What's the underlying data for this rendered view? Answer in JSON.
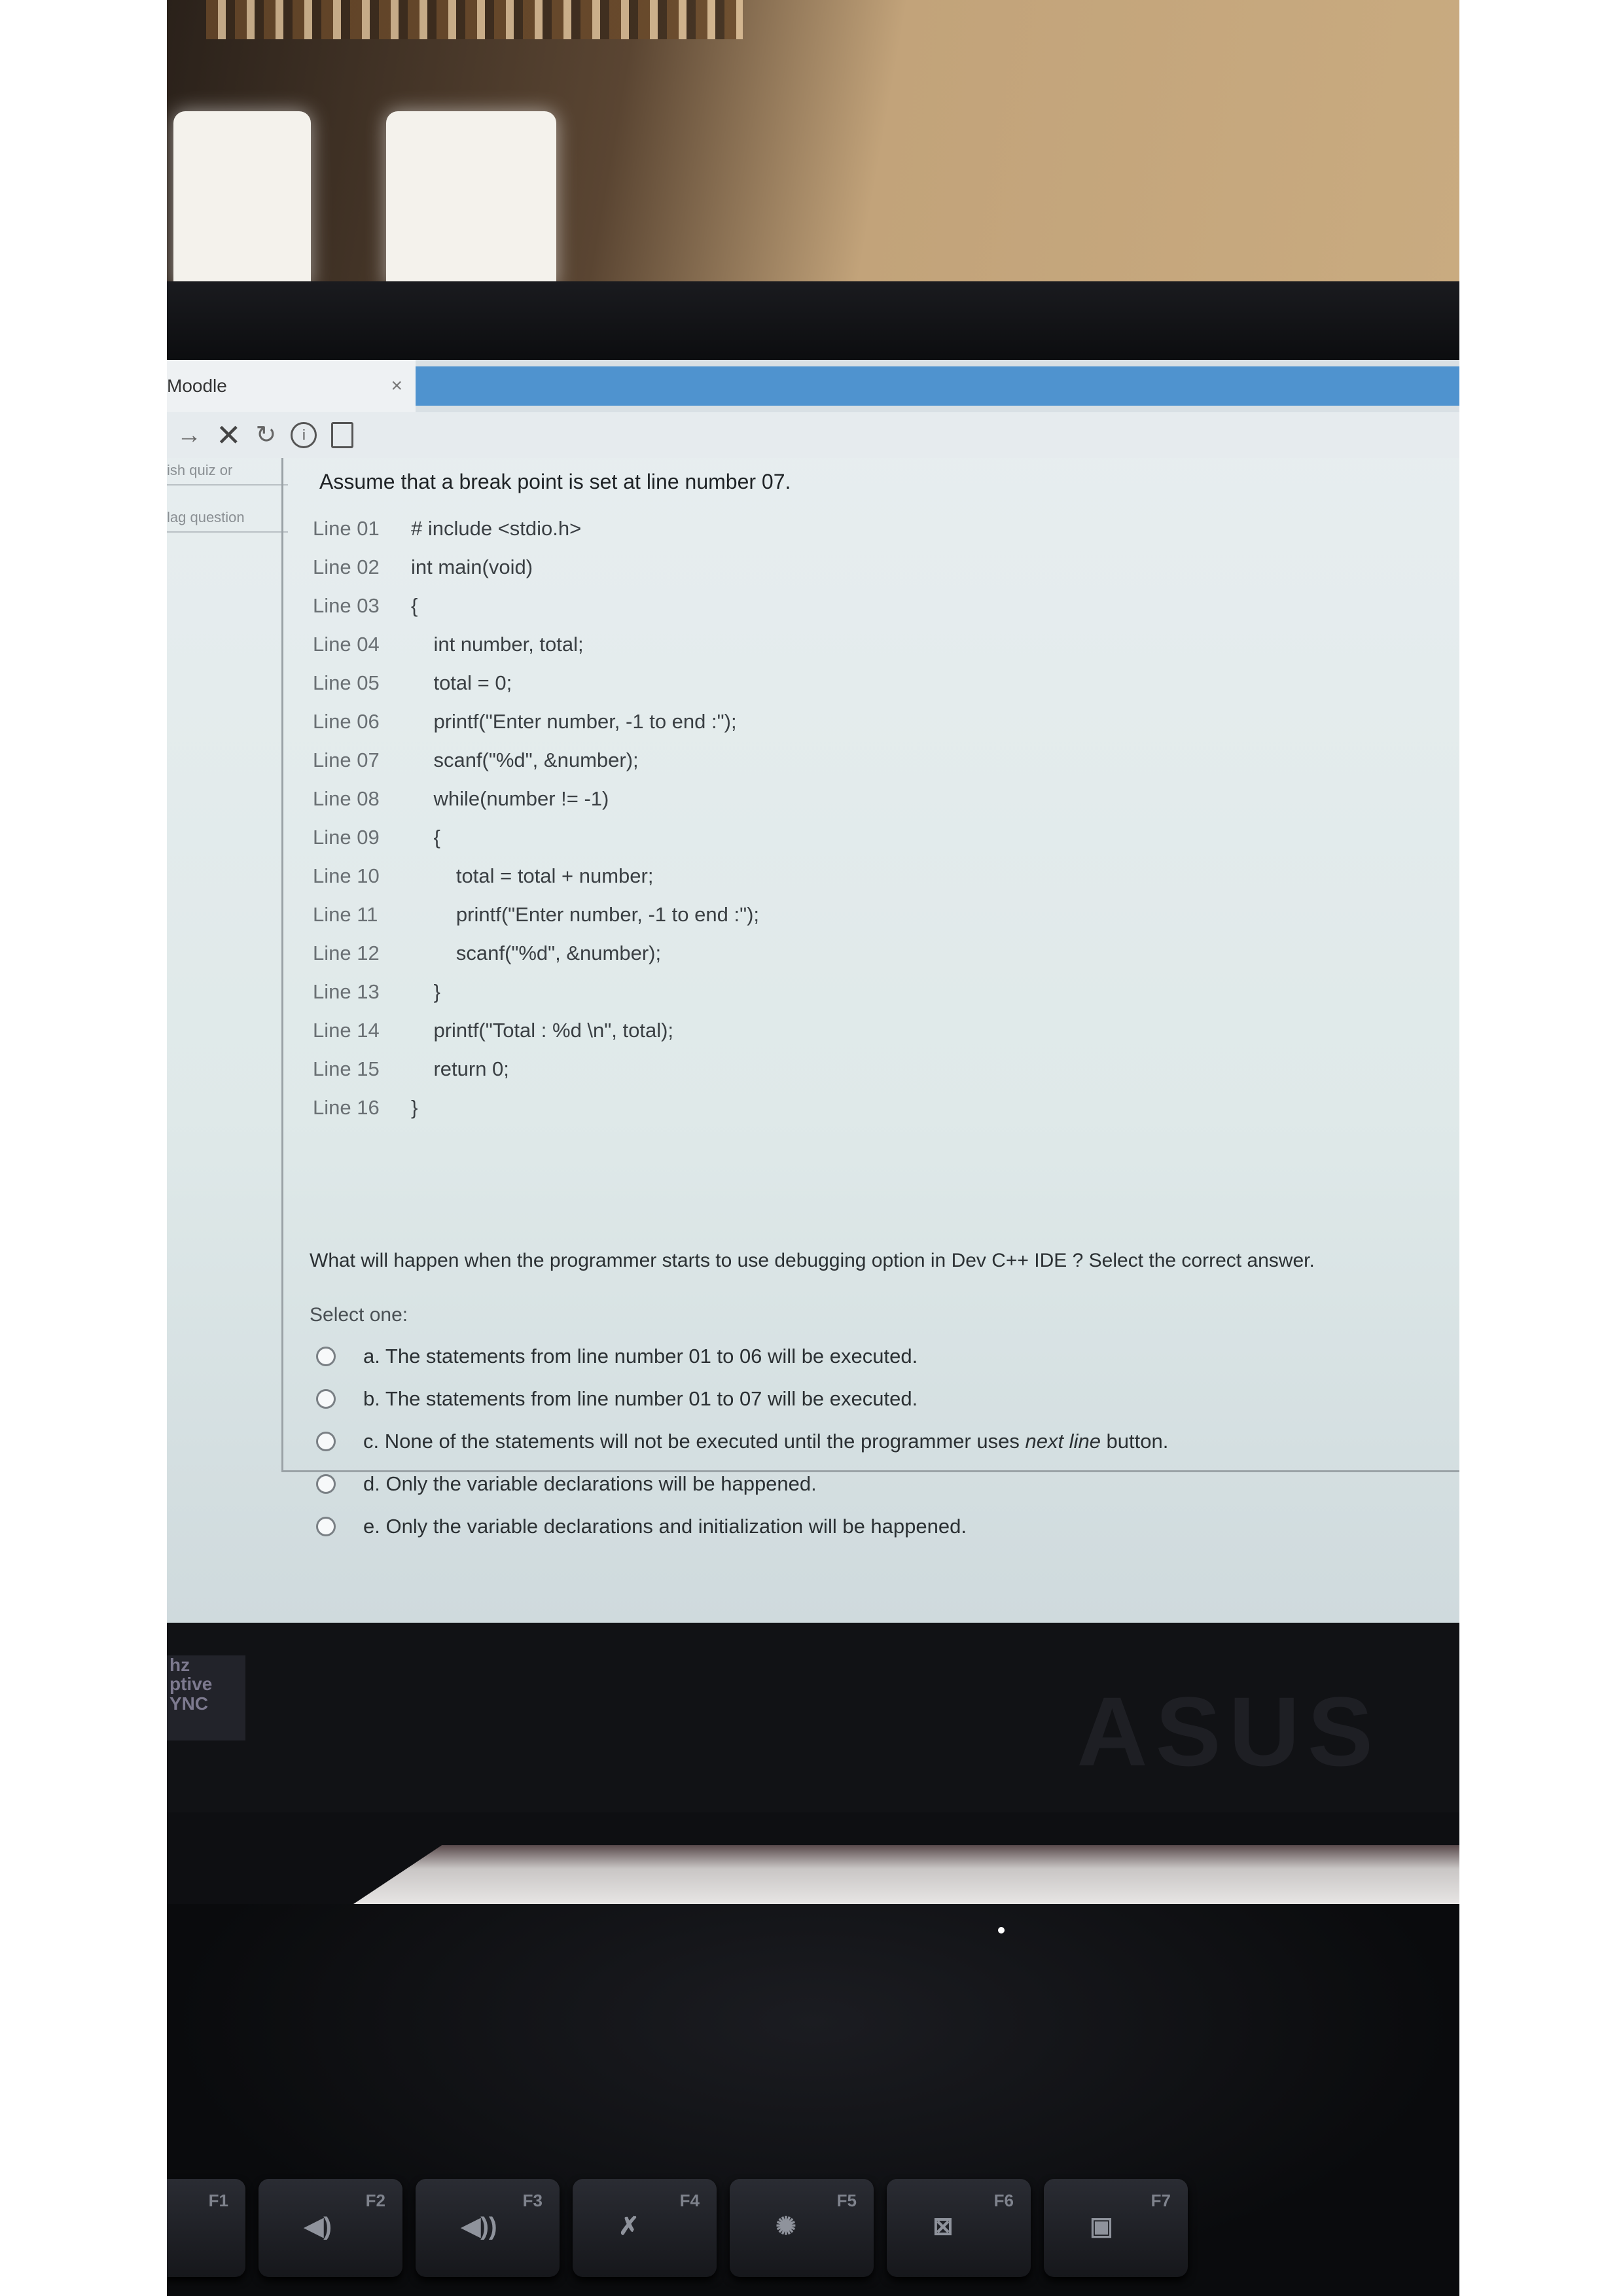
{
  "browser": {
    "tab_title": "Moodle",
    "tab_close": "×",
    "toolbar": {
      "back": "→",
      "stop": "✕",
      "reload": "↻",
      "info": "i"
    }
  },
  "nav": {
    "items": [
      "ish quiz or",
      "lag question"
    ]
  },
  "question": {
    "stem": "Assume that a  break point is set at line number 07.",
    "code": [
      {
        "ln": "Line 01",
        "text": "# include <stdio.h>"
      },
      {
        "ln": "Line 02",
        "text": "int main(void)"
      },
      {
        "ln": "Line 03",
        "text": "{"
      },
      {
        "ln": "Line 04",
        "text": "    int number, total;"
      },
      {
        "ln": "Line 05",
        "text": "    total = 0;"
      },
      {
        "ln": "Line 06",
        "text": "    printf(\"Enter number, -1 to end :\");"
      },
      {
        "ln": "Line 07",
        "text": "    scanf(\"%d\", &number);"
      },
      {
        "ln": "Line 08",
        "text": "    while(number != -1)"
      },
      {
        "ln": "Line 09",
        "text": "    {"
      },
      {
        "ln": "Line 10",
        "text": "        total = total + number;"
      },
      {
        "ln": "Line 11",
        "text": "        printf(\"Enter number, -1 to end :\");"
      },
      {
        "ln": "Line 12",
        "text": "        scanf(\"%d\", &number);"
      },
      {
        "ln": "Line 13",
        "text": "    }"
      },
      {
        "ln": "Line 14",
        "text": "    printf(\"Total : %d \\n\", total);"
      },
      {
        "ln": "Line 15",
        "text": "    return 0;"
      },
      {
        "ln": "Line 16",
        "text": "}"
      }
    ],
    "prompt": "What will happen when the programmer starts to use debugging option in Dev C++ IDE ? Select the correct answer.",
    "select_one": "Select one:",
    "options": {
      "a": "a. The statements from line number 01 to 06 will be executed.",
      "b": "b. The statements from line number 01 to 07 will be executed.",
      "c_pre": "c. None of the statements will not be executed until the programmer uses ",
      "c_em": "next line",
      "c_post": " button.",
      "d": "d. Only the variable declarations will be happened.",
      "e": "e. Only the variable declarations and initialization will be happened."
    }
  },
  "laptop": {
    "sticker": [
      "hz",
      "ptive",
      "YNC"
    ],
    "brand": "ASUS",
    "fkeys": [
      {
        "label": "F1",
        "icon": "✱"
      },
      {
        "label": "F2",
        "icon": "◀)"
      },
      {
        "label": "F3",
        "icon": "◀))"
      },
      {
        "label": "F4",
        "icon": "✗"
      },
      {
        "label": "F5",
        "icon": "✺"
      },
      {
        "label": "F6",
        "icon": "⊠"
      },
      {
        "label": "F7",
        "icon": "▣"
      }
    ]
  }
}
